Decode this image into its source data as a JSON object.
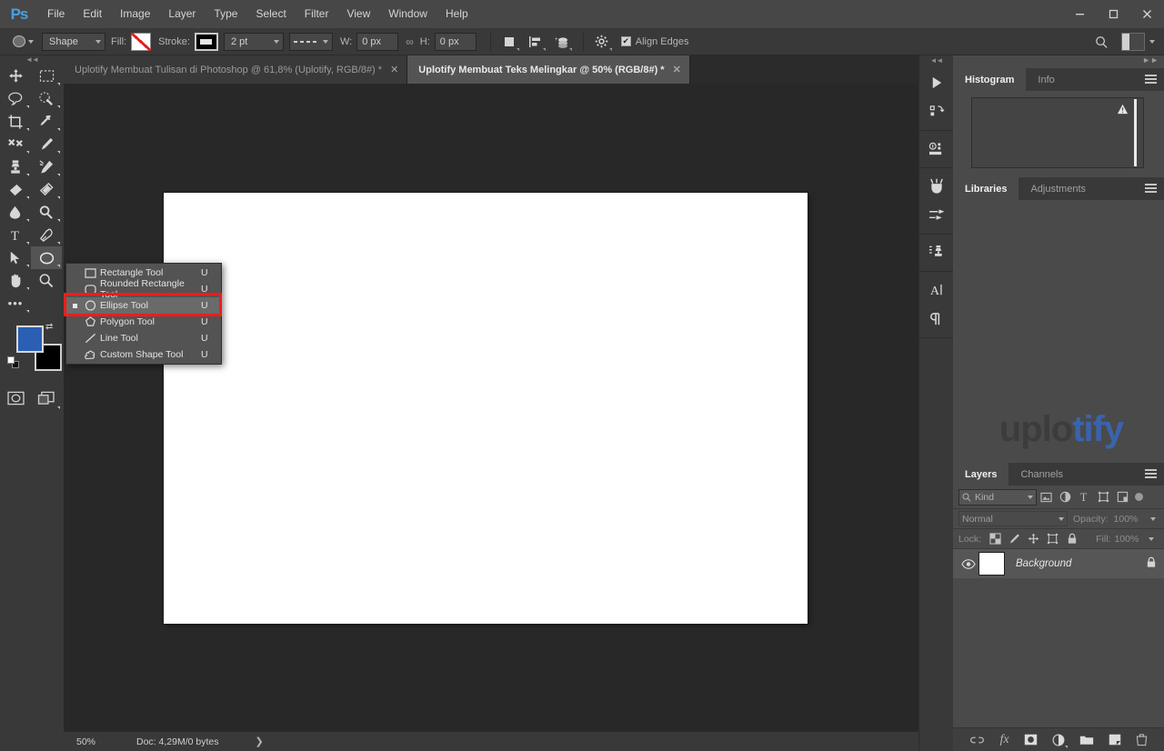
{
  "app": {
    "logo": "Ps"
  },
  "menubar": {
    "items": [
      "File",
      "Edit",
      "Image",
      "Layer",
      "Type",
      "Select",
      "Filter",
      "View",
      "Window",
      "Help"
    ]
  },
  "window_controls": {
    "minimize": "—",
    "maximize": "❐",
    "close": "✕"
  },
  "options_bar": {
    "tool_icon": "ellipse-tool-icon",
    "mode": "Shape",
    "fill_label": "Fill:",
    "fill_value": "none",
    "stroke_label": "Stroke:",
    "stroke_color": "#000000",
    "stroke_width": "2 pt",
    "stroke_dash": "dashed",
    "width_label": "W:",
    "width_value": "0 px",
    "link_icon": "link-icon",
    "height_label": "H:",
    "height_value": "0 px",
    "path_operations_icon": "path-operations-icon",
    "path_alignment_icon": "path-alignment-icon",
    "path_arrangement_icon": "path-arrangement-icon",
    "settings_icon": "gear-icon",
    "align_edges_label": "Align Edges",
    "align_edges_checked": true,
    "search_icon": "search-icon",
    "workspace_icon": "workspace-switcher-icon"
  },
  "tabs": [
    {
      "title": "Uplotify Membuat Tulisan di Photoshop @ 61,8%  (Uplotify, RGB/8#) *",
      "close": "✕",
      "active": false
    },
    {
      "title": "Uplotify Membuat Teks Melingkar @ 50% (RGB/8#) *",
      "close": "✕",
      "active": true
    }
  ],
  "toolbar": {
    "grip": "◄◄",
    "tools": [
      {
        "name": "move-tool",
        "has_flyout": false
      },
      {
        "name": "rectangular-marquee-tool",
        "has_flyout": true
      },
      {
        "name": "lasso-tool",
        "has_flyout": true
      },
      {
        "name": "quick-selection-tool",
        "has_flyout": true
      },
      {
        "name": "crop-tool",
        "has_flyout": true
      },
      {
        "name": "eyedropper-tool",
        "has_flyout": true
      },
      {
        "name": "healing-brush-tool",
        "has_flyout": true
      },
      {
        "name": "brush-tool",
        "has_flyout": true
      },
      {
        "name": "clone-stamp-tool",
        "has_flyout": true
      },
      {
        "name": "history-brush-tool",
        "has_flyout": true
      },
      {
        "name": "eraser-tool",
        "has_flyout": true
      },
      {
        "name": "gradient-tool",
        "has_flyout": true
      },
      {
        "name": "blur-tool",
        "has_flyout": true
      },
      {
        "name": "dodge-tool",
        "has_flyout": true
      },
      {
        "name": "type-tool",
        "has_flyout": true
      },
      {
        "name": "pen-tool",
        "has_flyout": true
      },
      {
        "name": "path-selection-tool",
        "has_flyout": true
      },
      {
        "name": "ellipse-tool",
        "has_flyout": true,
        "selected": true
      },
      {
        "name": "hand-tool",
        "has_flyout": true
      },
      {
        "name": "zoom-tool",
        "has_flyout": true
      }
    ],
    "more_tools": "•••",
    "foreground_color": "#2a5fb4",
    "background_color": "#000000",
    "quick_mask_icon": "quick-mask-icon",
    "screen_mode_icon": "screen-mode-icon"
  },
  "flyout_menu": {
    "items": [
      {
        "label": "Rectangle Tool",
        "shortcut": "U",
        "icon": "rectangle-icon",
        "selected": false
      },
      {
        "label": "Rounded Rectangle Tool",
        "shortcut": "U",
        "icon": "rounded-rectangle-icon",
        "selected": false
      },
      {
        "label": "Ellipse Tool",
        "shortcut": "U",
        "icon": "ellipse-icon",
        "selected": true
      },
      {
        "label": "Polygon Tool",
        "shortcut": "U",
        "icon": "polygon-icon",
        "selected": false
      },
      {
        "label": "Line Tool",
        "shortcut": "U",
        "icon": "line-icon",
        "selected": false
      },
      {
        "label": "Custom Shape Tool",
        "shortcut": "U",
        "icon": "custom-shape-icon",
        "selected": false
      }
    ],
    "highlight_color": "#ee1c1c"
  },
  "status_bar": {
    "zoom": "50%",
    "doc_info": "Doc: 4,29M/0 bytes",
    "expand_arrow": "❯"
  },
  "dock_rail": {
    "grip": "◄◄",
    "icons": [
      "play-actions-icon",
      "history-icon",
      "info-panel-icon",
      "brushes-icon",
      "brush-settings-icon",
      "clone-source-icon",
      "character-panel-icon",
      "paragraph-panel-icon"
    ]
  },
  "panels": {
    "histogram": {
      "tabs": [
        {
          "label": "Histogram",
          "active": true
        },
        {
          "label": "Info",
          "active": false
        }
      ],
      "menu_icon": "panel-menu-icon",
      "warning_icon": "warning-triangle-icon"
    },
    "libraries": {
      "tabs": [
        {
          "label": "Libraries",
          "active": true
        },
        {
          "label": "Adjustments",
          "active": false
        }
      ],
      "menu_icon": "panel-menu-icon",
      "watermark_part1": "uplo",
      "watermark_part2": "tify",
      "watermark_color1": "#3c3c3c",
      "watermark_color2": "#3a63ad"
    },
    "layers": {
      "tabs": [
        {
          "label": "Layers",
          "active": true
        },
        {
          "label": "Channels",
          "active": false
        }
      ],
      "menu_icon": "panel-menu-icon",
      "filter_kind": "Kind",
      "filter_icons": [
        "pixel-filter-icon",
        "adjustment-filter-icon",
        "type-filter-icon",
        "shape-filter-icon",
        "smartobject-filter-icon"
      ],
      "blend_mode": "Normal",
      "opacity_label": "Opacity:",
      "opacity_value": "100%",
      "lock_label": "Lock:",
      "lock_icons": [
        "lock-transparent-icon",
        "lock-image-icon",
        "lock-position-icon",
        "lock-artboard-icon",
        "lock-all-icon"
      ],
      "fill_label": "Fill:",
      "fill_value": "100%",
      "rows": [
        {
          "name": "Background",
          "visible": true,
          "locked": true,
          "thumb_color": "#ffffff"
        }
      ],
      "footer_icons": [
        "link-layers-icon",
        "layer-style-fx-icon",
        "layer-mask-icon",
        "adjustment-layer-icon",
        "new-group-icon",
        "new-layer-icon",
        "delete-layer-icon"
      ],
      "footer_fx_label": "fx"
    }
  }
}
